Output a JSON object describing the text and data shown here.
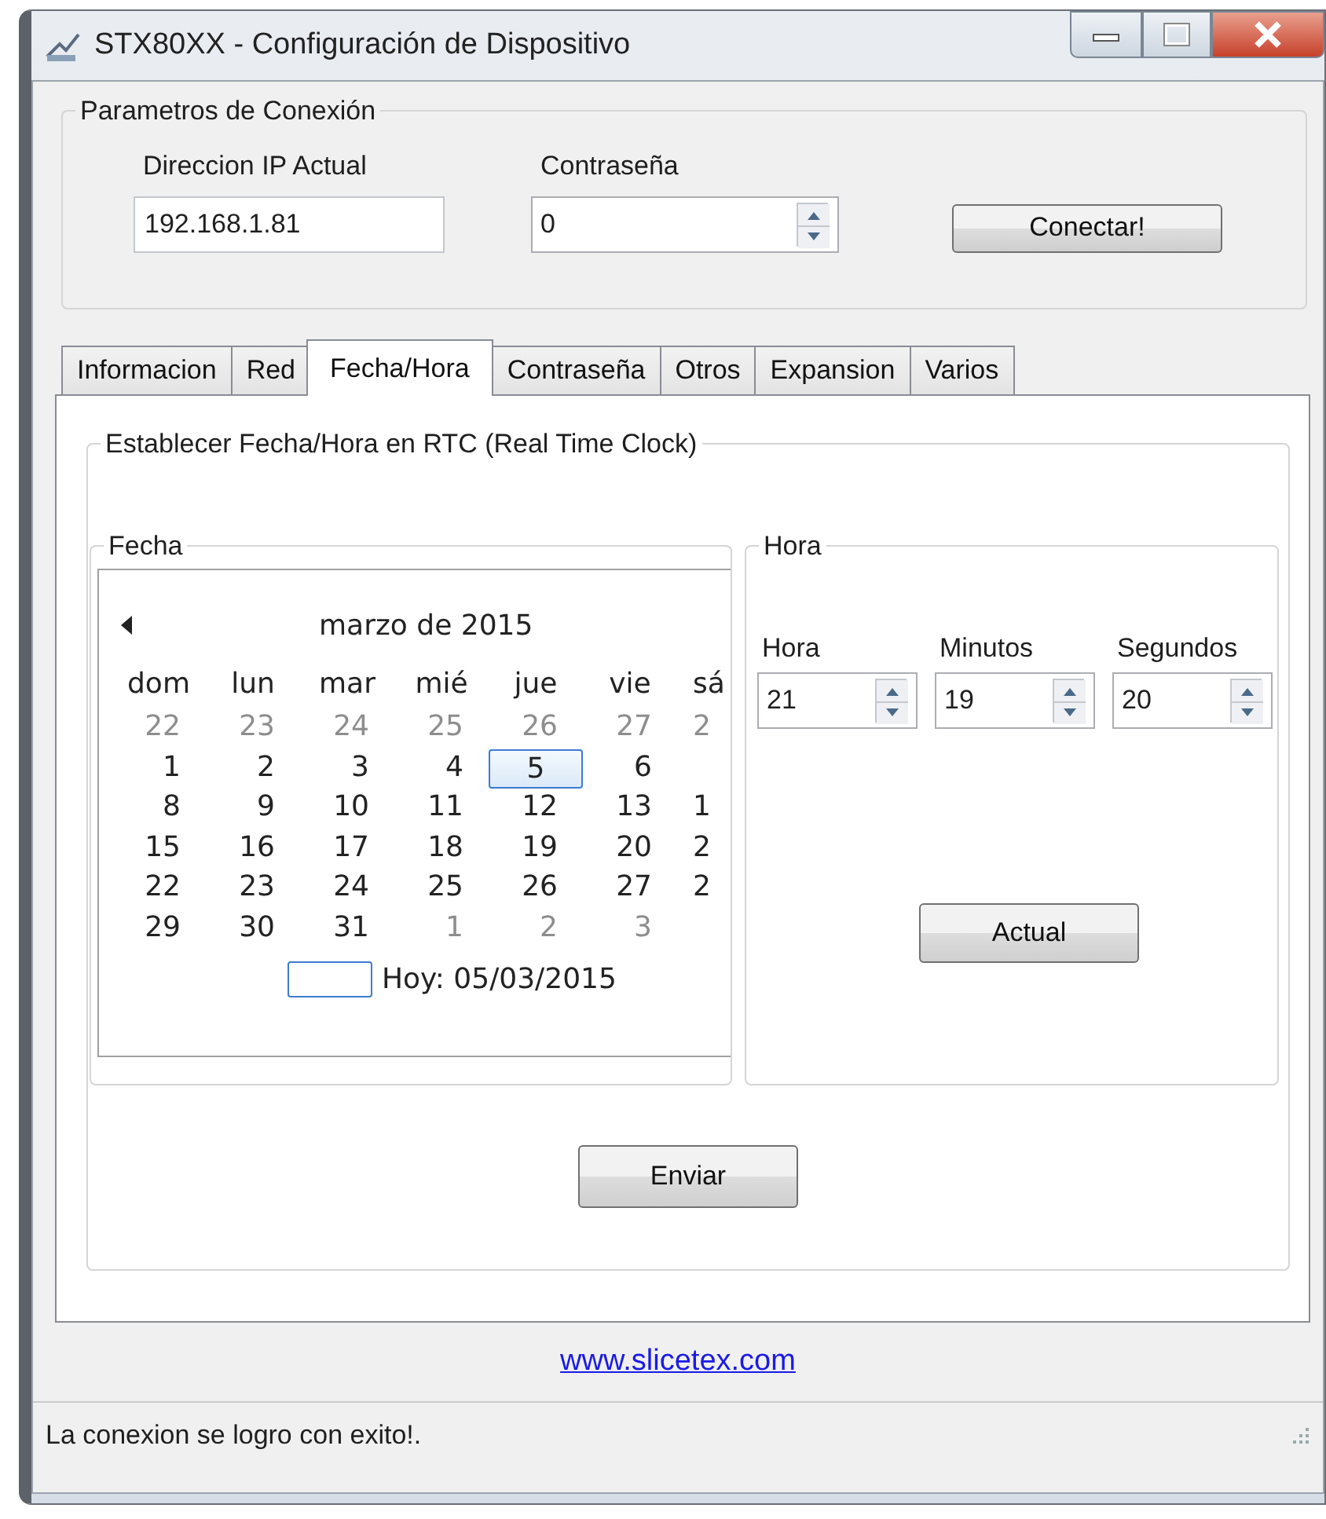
{
  "window": {
    "title": "STX80XX - Configuración de Dispositivo"
  },
  "connection": {
    "title": "Parametros de Conexión",
    "ip_label": "Direccion IP Actual",
    "ip_value": "192.168.1.81",
    "password_label": "Contraseña",
    "password_value": "0",
    "connect_button": "Conectar!"
  },
  "tabs": [
    {
      "label": "Informacion",
      "selected": false
    },
    {
      "label": "Red",
      "selected": false
    },
    {
      "label": "Fecha/Hora",
      "selected": true
    },
    {
      "label": "Contraseña",
      "selected": false
    },
    {
      "label": "Otros",
      "selected": false
    },
    {
      "label": "Expansion",
      "selected": false
    },
    {
      "label": "Varios",
      "selected": false
    }
  ],
  "rtc": {
    "title": "Establecer Fecha/Hora en RTC (Real Time Clock)",
    "date_group": {
      "title": "Fecha",
      "calendar": {
        "month": "marzo de 2015",
        "weekdays": [
          "dom",
          "lun",
          "mar",
          "mié",
          "jue",
          "vie",
          "sá"
        ],
        "weeks": [
          [
            {
              "day": "22",
              "muted": true,
              "selected": false
            },
            {
              "day": "23",
              "muted": true,
              "selected": false
            },
            {
              "day": "24",
              "muted": true,
              "selected": false
            },
            {
              "day": "25",
              "muted": true,
              "selected": false
            },
            {
              "day": "26",
              "muted": true,
              "selected": false
            },
            {
              "day": "27",
              "muted": true,
              "selected": false
            },
            {
              "day": "2",
              "muted": true,
              "selected": false
            }
          ],
          [
            {
              "day": "1",
              "muted": false,
              "selected": false
            },
            {
              "day": "2",
              "muted": false,
              "selected": false
            },
            {
              "day": "3",
              "muted": false,
              "selected": false
            },
            {
              "day": "4",
              "muted": false,
              "selected": false
            },
            {
              "day": "5",
              "muted": false,
              "selected": true
            },
            {
              "day": "6",
              "muted": false,
              "selected": false
            }
          ],
          [
            {
              "day": "8",
              "muted": false,
              "selected": false
            },
            {
              "day": "9",
              "muted": false,
              "selected": false
            },
            {
              "day": "10",
              "muted": false,
              "selected": false
            },
            {
              "day": "11",
              "muted": false,
              "selected": false
            },
            {
              "day": "12",
              "muted": false,
              "selected": false
            },
            {
              "day": "13",
              "muted": false,
              "selected": false
            },
            {
              "day": "1",
              "muted": false,
              "selected": false
            }
          ],
          [
            {
              "day": "15",
              "muted": false,
              "selected": false
            },
            {
              "day": "16",
              "muted": false,
              "selected": false
            },
            {
              "day": "17",
              "muted": false,
              "selected": false
            },
            {
              "day": "18",
              "muted": false,
              "selected": false
            },
            {
              "day": "19",
              "muted": false,
              "selected": false
            },
            {
              "day": "20",
              "muted": false,
              "selected": false
            },
            {
              "day": "2",
              "muted": false,
              "selected": false
            }
          ],
          [
            {
              "day": "22",
              "muted": false,
              "selected": false
            },
            {
              "day": "23",
              "muted": false,
              "selected": false
            },
            {
              "day": "24",
              "muted": false,
              "selected": false
            },
            {
              "day": "25",
              "muted": false,
              "selected": false
            },
            {
              "day": "26",
              "muted": false,
              "selected": false
            },
            {
              "day": "27",
              "muted": false,
              "selected": false
            },
            {
              "day": "2",
              "muted": false,
              "selected": false
            }
          ],
          [
            {
              "day": "29",
              "muted": false,
              "selected": false
            },
            {
              "day": "30",
              "muted": false,
              "selected": false
            },
            {
              "day": "31",
              "muted": false,
              "selected": false
            },
            {
              "day": "1",
              "muted": true,
              "selected": false
            },
            {
              "day": "2",
              "muted": true,
              "selected": false
            },
            {
              "day": "3",
              "muted": true,
              "selected": false
            }
          ]
        ],
        "today": "Hoy: 05/03/2015"
      }
    },
    "time_group": {
      "title": "Hora",
      "fields": [
        {
          "label": "Hora",
          "value": "21"
        },
        {
          "label": "Minutos",
          "value": "19"
        },
        {
          "label": "Segundos",
          "value": "20"
        }
      ],
      "button": "Actual"
    },
    "send_button": "Enviar"
  },
  "link": "www.slicetex.com",
  "status_bar": "La conexion se logro con exito!."
}
